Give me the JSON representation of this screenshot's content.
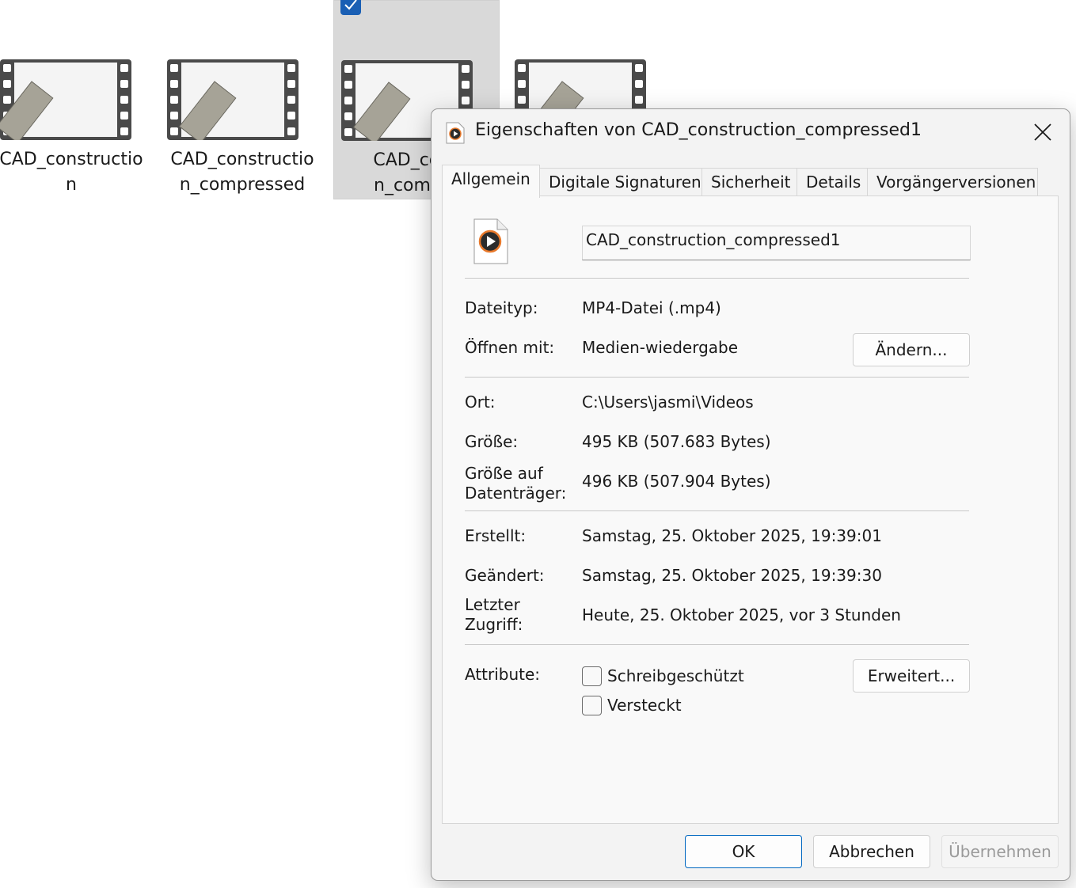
{
  "explorer": {
    "files": [
      {
        "name": "CAD_construction",
        "selected": false
      },
      {
        "name": "CAD_construction_compressed",
        "selected": false
      },
      {
        "name": "CAD_construction_compressed1",
        "selected": true
      },
      {
        "name": "",
        "selected": false
      }
    ],
    "visible_names": [
      "CAD_constructio n",
      "CAD_constructio n_compressed",
      "CAD_cons n_compre"
    ]
  },
  "dialog": {
    "title": "Eigenschaften von CAD_construction_compressed1",
    "tabs": [
      "Allgemein",
      "Digitale Signaturen",
      "Sicherheit",
      "Details",
      "Vorgängerversionen"
    ],
    "active_tab": "Allgemein",
    "file_name": "CAD_construction_compressed1",
    "labels": {
      "filetype": "Dateityp:",
      "open_with": "Öffnen mit:",
      "location": "Ort:",
      "size": "Größe:",
      "size_on_disk_1": "Größe auf",
      "size_on_disk_2": "Datenträger:",
      "created": "Erstellt:",
      "modified": "Geändert:",
      "accessed_1": "Letzter",
      "accessed_2": "Zugriff:",
      "attributes": "Attribute:"
    },
    "values": {
      "filetype": "MP4-Datei (.mp4)",
      "open_with": "Medien-wiedergabe",
      "location": "C:\\Users\\jasmi\\Videos",
      "size": "495 KB (507.683 Bytes)",
      "size_on_disk": "496 KB (507.904 Bytes)",
      "created": "Samstag, 25. Oktober 2025, 19:39:01",
      "modified": "Samstag, 25. Oktober 2025, 19:39:30",
      "accessed": "Heute, 25. Oktober 2025, vor 3 Stunden"
    },
    "buttons": {
      "change": "Ändern...",
      "advanced": "Erweitert...",
      "ok": "OK",
      "cancel": "Abbrechen",
      "apply": "Übernehmen"
    },
    "attributes": {
      "readonly": "Schreibgeschützt",
      "readonly_checked": false,
      "hidden": "Versteckt",
      "hidden_checked": false
    },
    "colors": {
      "accent": "#0067c0",
      "selection": "#d9d9d9",
      "check": "#1a5fb4"
    }
  }
}
